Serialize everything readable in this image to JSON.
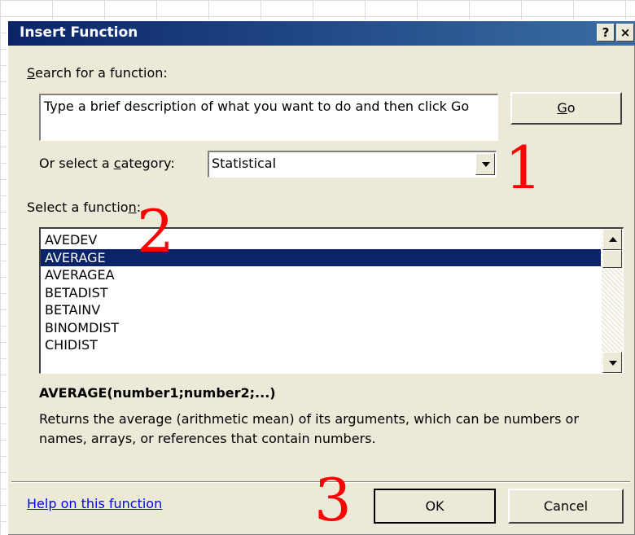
{
  "dialog": {
    "title": "Insert Function",
    "help_glyph": "?",
    "close_glyph": "×"
  },
  "search": {
    "label_prefix": "",
    "label_access": "S",
    "label_rest": "earch for a function:",
    "value": "Type a brief description of what you want to do and then click Go",
    "go_label_access": "G",
    "go_label_rest": "o"
  },
  "category": {
    "label_pre": "Or select a ",
    "label_access": "c",
    "label_post": "ategory:",
    "value": "Statistical"
  },
  "functions": {
    "label_pre": "Select a functio",
    "label_access": "n",
    "label_post": ":",
    "items": [
      "AVEDEV",
      "AVERAGE",
      "AVERAGEA",
      "BETADIST",
      "BETAINV",
      "BINOMDIST",
      "CHIDIST"
    ],
    "selected_index": 1
  },
  "details": {
    "signature": "AVERAGE(number1;number2;...)",
    "description": "Returns the average (arithmetic mean) of its arguments, which can be numbers or names, arrays, or references that contain numbers."
  },
  "footer": {
    "help_link": "Help on this function",
    "ok_label": "OK",
    "cancel_label": "Cancel"
  },
  "annotations": [
    "1",
    "2",
    "3"
  ],
  "colors": {
    "titlebar": "#0a246a",
    "selection": "#0a246a",
    "annotation": "#ff0000",
    "link": "#0000ff",
    "dialog_bg": "#ece9d8"
  }
}
